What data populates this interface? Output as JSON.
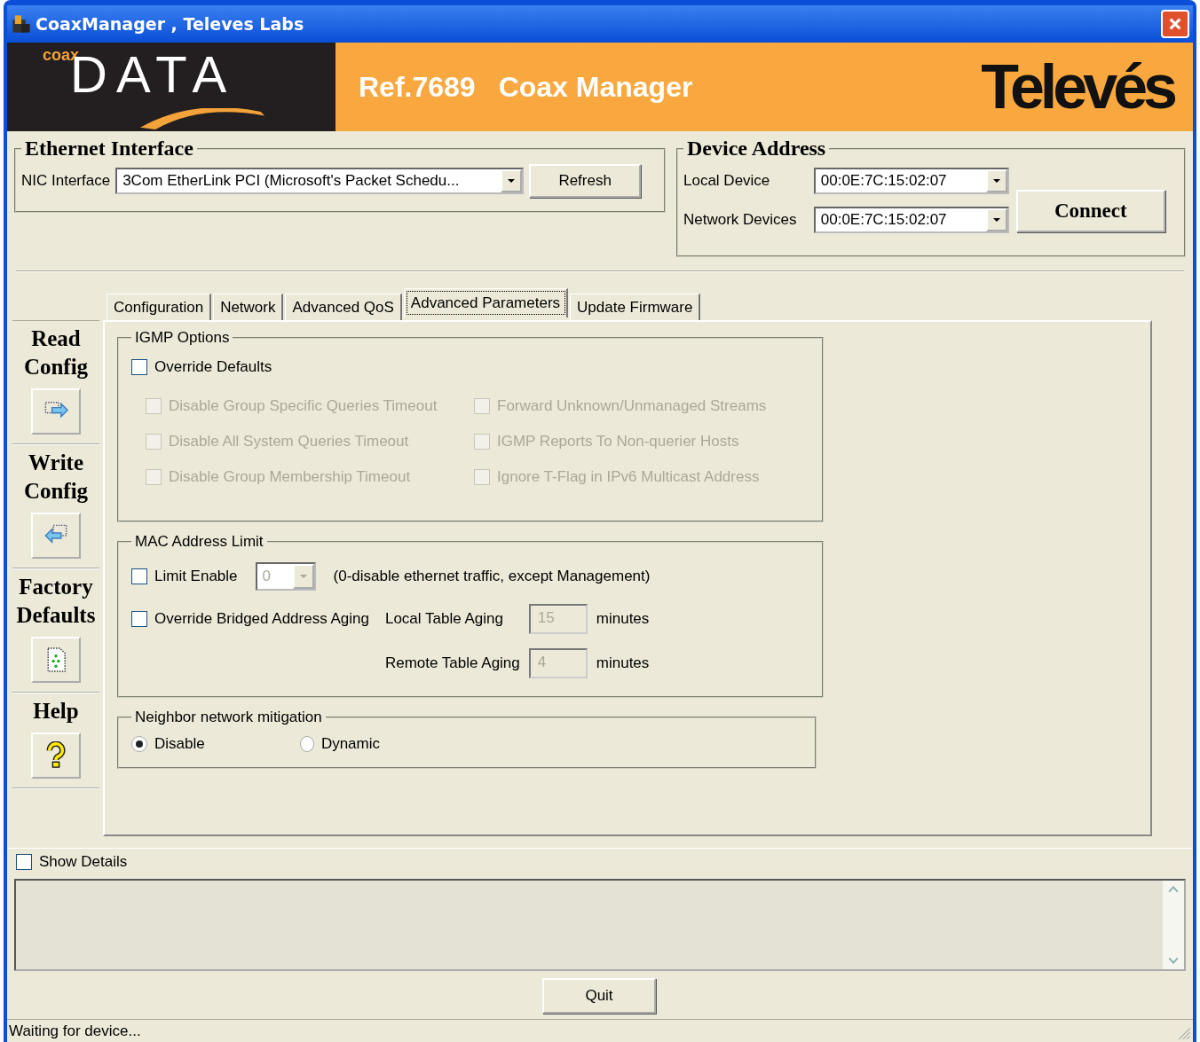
{
  "window": {
    "title": "CoaxManager , Televes Labs"
  },
  "banner": {
    "logo_small": "coax",
    "logo_main": "DATA",
    "ref": "Ref.7689",
    "product": "Coax Manager",
    "brand": "Televés"
  },
  "ethernet": {
    "title": "Ethernet Interface",
    "nic_label": "NIC Interface",
    "nic_value": "3Com EtherLink PCI (Microsoft's Packet Schedu...",
    "refresh": "Refresh"
  },
  "device": {
    "title": "Device Address",
    "local_label": "Local Device",
    "local_value": "00:0E:7C:15:02:07",
    "network_label": "Network Devices",
    "network_value": "00:0E:7C:15:02:07",
    "connect": "Connect"
  },
  "sidebar": [
    {
      "label": "Read Config"
    },
    {
      "label": "Write Config"
    },
    {
      "label": "Factory Defaults"
    },
    {
      "label": "Help"
    }
  ],
  "tabs": [
    {
      "label": "Configuration",
      "selected": false
    },
    {
      "label": "Network",
      "selected": false
    },
    {
      "label": "Advanced QoS",
      "selected": false
    },
    {
      "label": "Advanced Parameters",
      "selected": true
    },
    {
      "label": "Update Firmware",
      "selected": false
    }
  ],
  "igmp": {
    "title": "IGMP Options",
    "override": {
      "label": "Override Defaults",
      "checked": false,
      "disabled": false
    },
    "options": [
      {
        "label": "Disable Group Specific Queries Timeout",
        "checked": false,
        "disabled": true
      },
      {
        "label": "Forward Unknown/Unmanaged Streams",
        "checked": false,
        "disabled": true
      },
      {
        "label": "Disable All System Queries Timeout",
        "checked": false,
        "disabled": true
      },
      {
        "label": "IGMP Reports To Non-querier Hosts",
        "checked": false,
        "disabled": true
      },
      {
        "label": "Disable Group Membership Timeout",
        "checked": false,
        "disabled": true
      },
      {
        "label": "Ignore T-Flag in IPv6 Multicast Address",
        "checked": false,
        "disabled": true
      }
    ]
  },
  "mac": {
    "title": "MAC Address Limit",
    "limit": {
      "label": "Limit Enable",
      "checked": false,
      "disabled": false
    },
    "limit_value": "0",
    "note": "(0-disable ethernet traffic, except Management)",
    "override": {
      "label": "Override Bridged Address Aging",
      "checked": false,
      "disabled": false
    },
    "local_label": "Local Table Aging",
    "local_value": "15",
    "local_unit": "minutes",
    "remote_label": "Remote Table Aging",
    "remote_value": "4",
    "remote_unit": "minutes"
  },
  "neighbor": {
    "title": "Neighbor network mitigation",
    "options": [
      {
        "label": "Disable",
        "selected": true
      },
      {
        "label": "Dynamic",
        "selected": false
      }
    ]
  },
  "show_details": {
    "label": "Show Details",
    "checked": false
  },
  "quit": "Quit",
  "status_bar": "Waiting for device..."
}
